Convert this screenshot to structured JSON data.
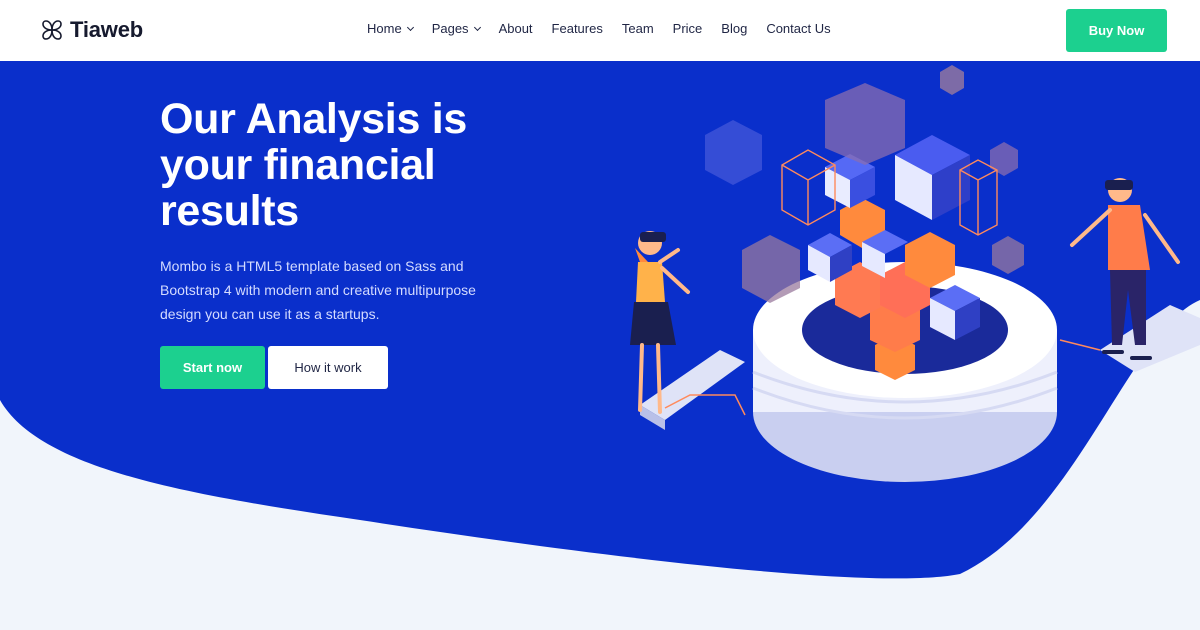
{
  "header": {
    "logo_text": "Tiaweb",
    "nav": [
      {
        "label": "Home",
        "dropdown": true
      },
      {
        "label": "Pages",
        "dropdown": true
      },
      {
        "label": "About",
        "dropdown": false
      },
      {
        "label": "Features",
        "dropdown": false
      },
      {
        "label": "Team",
        "dropdown": false
      },
      {
        "label": "Price",
        "dropdown": false
      },
      {
        "label": "Blog",
        "dropdown": false
      },
      {
        "label": "Contact Us",
        "dropdown": false
      }
    ],
    "buy_label": "Buy Now"
  },
  "hero": {
    "title": "Our Analysis is your financial results",
    "description": "Mombo is a HTML5 template based on Sass and Bootstrap 4 with modern and creative multipurpose design you can use it as a startups.",
    "primary_cta": "Start now",
    "secondary_cta": "How it work"
  },
  "colors": {
    "accent_green": "#1cd08f",
    "hero_blue": "#0a2fcb",
    "page_background": "#f1f5fb",
    "text_dark": "#1f2544"
  },
  "icons": {
    "logo": "four-petal-logo-icon",
    "dropdown": "chevron-down-icon"
  }
}
